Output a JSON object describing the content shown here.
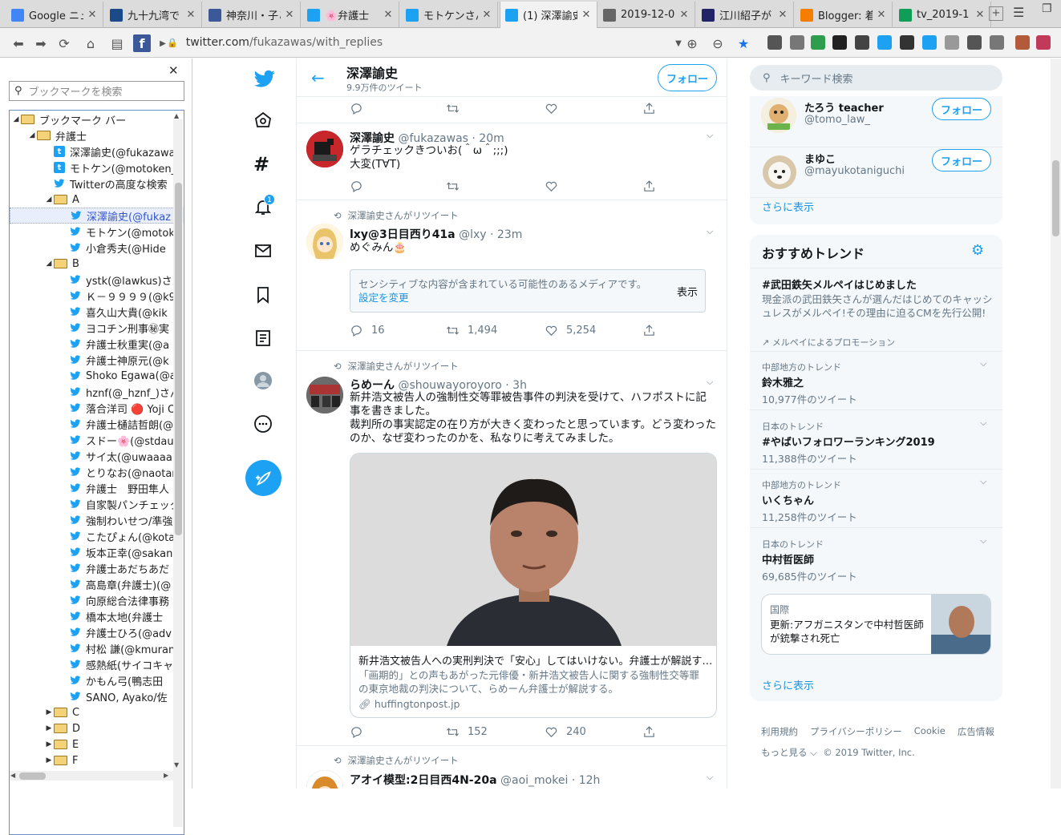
{
  "tabs": [
    {
      "title": "Google ニュ",
      "icon": "google-news-icon",
      "color": "#4285f4"
    },
    {
      "title": "九十九湾で",
      "icon": "site-icon",
      "color": "#1a4a8a"
    },
    {
      "title": "神奈川・子ど",
      "icon": "facebook-icon",
      "color": "#3b5998"
    },
    {
      "title": "🌸弁護士 ",
      "icon": "twitter-icon",
      "color": "#1da1f2"
    },
    {
      "title": "モトケンさん",
      "icon": "twitter-icon",
      "color": "#1da1f2"
    },
    {
      "title": "(1) 深澤諭史",
      "icon": "twitter-icon",
      "color": "#1da1f2"
    },
    {
      "title": "2019-12-0",
      "icon": "globe-icon",
      "color": "#666666"
    },
    {
      "title": "江川紹子が",
      "icon": "bj-icon",
      "color": "#222266"
    },
    {
      "title": "Blogger: 着",
      "icon": "blogger-icon",
      "color": "#f57d00"
    },
    {
      "title": "tv_2019-1",
      "icon": "drive-icon",
      "color": "#0f9d58"
    }
  ],
  "url": {
    "host": "twitter.com",
    "path": "/fukazawas/with_replies"
  },
  "bookmarks": {
    "search_placeholder": "ブックマークを検索",
    "items": [
      {
        "label": "ブックマーク バー",
        "kind": "folder",
        "arrow": "◢",
        "level": 0
      },
      {
        "label": "弁護士",
        "kind": "folder",
        "arrow": "◢",
        "level": 1
      },
      {
        "label": "深澤諭史(@fukazawa",
        "kind": "tsq",
        "level": 2
      },
      {
        "label": "モトケン(@motoken_",
        "kind": "tsq",
        "level": 2
      },
      {
        "label": "Twitterの高度な検索",
        "kind": "bird",
        "level": 2
      },
      {
        "label": "A",
        "kind": "folder",
        "arrow": "◢",
        "level": 2
      },
      {
        "label": "深澤諭史(@fukaz",
        "kind": "bird",
        "level": 3,
        "selected": true
      },
      {
        "label": "モトケン(@motok",
        "kind": "bird",
        "level": 3
      },
      {
        "label": "小倉秀夫(@Hide",
        "kind": "bird",
        "level": 3
      },
      {
        "label": "B",
        "kind": "folder",
        "arrow": "◢",
        "level": 2
      },
      {
        "label": "ystk(@lawkus)さん",
        "kind": "bird",
        "level": 3
      },
      {
        "label": "Ｋ－９９９９(@k99",
        "kind": "bird",
        "level": 3
      },
      {
        "label": "喜久山大貴(@kik",
        "kind": "bird",
        "level": 3
      },
      {
        "label": "ヨコチン刑事㊙実",
        "kind": "bird",
        "level": 3
      },
      {
        "label": "弁護士秋重実(@a",
        "kind": "bird",
        "level": 3
      },
      {
        "label": "弁護士神原元(@k",
        "kind": "bird",
        "level": 3
      },
      {
        "label": "Shoko Egawa(@a",
        "kind": "bird",
        "level": 3
      },
      {
        "label": "hznf(@_hznf_)さん",
        "kind": "bird",
        "level": 3
      },
      {
        "label": "落合洋司 🔴 Yoji O",
        "kind": "bird",
        "level": 3
      },
      {
        "label": "弁護士樋詰哲朗(@",
        "kind": "bird",
        "level": 3
      },
      {
        "label": "スドー🌸(@stdau",
        "kind": "bird",
        "level": 3
      },
      {
        "label": "サイ太(@uwaaaa)",
        "kind": "bird",
        "level": 3
      },
      {
        "label": "とりなお(@naotar",
        "kind": "bird",
        "level": 3
      },
      {
        "label": "弁護士　野田隼人",
        "kind": "bird",
        "level": 3
      },
      {
        "label": "自家製パンチェッタ",
        "kind": "bird",
        "level": 3
      },
      {
        "label": "強制わいせつ/準強",
        "kind": "bird",
        "level": 3
      },
      {
        "label": "こたぴょん(@kotac",
        "kind": "bird",
        "level": 3
      },
      {
        "label": "坂本正幸(@sakan",
        "kind": "bird",
        "level": 3
      },
      {
        "label": "弁護士あだちあだ",
        "kind": "bird",
        "level": 3
      },
      {
        "label": "高島章(弁護士)(@",
        "kind": "bird",
        "level": 3
      },
      {
        "label": "向原総合法律事務",
        "kind": "bird",
        "level": 3
      },
      {
        "label": "橋本太地(弁護士",
        "kind": "bird",
        "level": 3
      },
      {
        "label": "弁護士ひろ(@adv",
        "kind": "bird",
        "level": 3
      },
      {
        "label": "村松 謙(@kmuran",
        "kind": "bird",
        "level": 3
      },
      {
        "label": "感熱紙(サイコキャ",
        "kind": "bird",
        "level": 3
      },
      {
        "label": "かもん弓(鴨志田",
        "kind": "bird",
        "level": 3
      },
      {
        "label": "SANO, Ayako/佐",
        "kind": "bird",
        "level": 3
      },
      {
        "label": "C",
        "kind": "folder",
        "arrow": "▶",
        "level": 2
      },
      {
        "label": "D",
        "kind": "folder",
        "arrow": "▶",
        "level": 2
      },
      {
        "label": "E",
        "kind": "folder",
        "arrow": "▶",
        "level": 2
      },
      {
        "label": "F",
        "kind": "folder",
        "arrow": "▶",
        "level": 2
      }
    ]
  },
  "nav": {
    "notif_count": "1"
  },
  "header": {
    "name": "深澤諭史",
    "count": "9.9万件のツイート",
    "follow": "フォロー"
  },
  "tweets": {
    "t1": {
      "name": "深澤諭史",
      "handle": "@fukazawas",
      "time": "· 20m",
      "lines": [
        "ゲラチェックきついお(＾ω＾;;;)",
        "大変(T∀T)"
      ]
    },
    "t2": {
      "rt": "深澤諭史さんがリツイート",
      "name": "lxy@3日目西り41a",
      "handle": "@lxy",
      "time": "· 23m",
      "text": "めぐみん🎂",
      "sensitive": "センシティブな内容が含まれている可能性のあるメディアです。",
      "sensitive_link": "設定を変更",
      "show": "表示",
      "replies": "16",
      "retweets": "1,494",
      "likes": "5,254"
    },
    "t3": {
      "rt": "深澤諭史さんがリツイート",
      "name": "らめーん",
      "handle": "@shouwayoroyoro",
      "time": "· 3h",
      "p1": "新井浩文被告人の強制性交等罪被告事件の判決を受けて、ハフポストに記事を書きました。",
      "p2": "裁判所の事実認定の在り方が大きく変わったと思っています。どう変わったのか、なぜ変わったのかを、私なりに考えてみました。",
      "card_title": "新井浩文被告人への実刑判決で「安心」してはいけない。弁護士が解説す…",
      "card_desc": "「画期的」との声もあがった元俳優・新井浩文被告人に関する強制性交等罪の東京地裁の判決について、らめーん弁護士が解説する。",
      "card_domain": "huffingtonpost.jp",
      "replies": "",
      "retweets": "152",
      "likes": "240"
    },
    "t4": {
      "rt": "深澤諭史さんがリツイート",
      "name": "アオイ模型:2日目西4N-20a",
      "handle": "@aoi_mokei",
      "time": "· 12h"
    }
  },
  "right": {
    "search_placeholder": "キーワード検索",
    "follow": "フォロー",
    "users": [
      {
        "name": "たろう teacher",
        "handle": "@tomo_law_"
      },
      {
        "name": "まゆこ",
        "handle": "@mayukotaniguchi"
      }
    ],
    "show_more": "さらに表示",
    "trends_title": "おすすめトレンド",
    "promoted": {
      "name": "#武田鉄矢メルペイはじめました",
      "desc": "現金派の武田鉄矢さんが選んだはじめてのキャッシュレスがメルペイ!その理由に迫るCMを先行公開!",
      "by": "メルペイによるプロモーション"
    },
    "trends": [
      {
        "context": "中部地方のトレンド",
        "name": "鈴木雅之",
        "count": "10,977件のツイート"
      },
      {
        "context": "日本のトレンド",
        "name": "#やばいフォロワーランキング2019",
        "count": "11,388件のツイート"
      },
      {
        "context": "中部地方のトレンド",
        "name": "いくちゃん",
        "count": "11,258件のツイート"
      },
      {
        "context": "日本のトレンド",
        "name": "中村哲医師",
        "count": "69,685件のツイート"
      }
    ],
    "news": {
      "category": "国際",
      "headline": "更新:アフガニスタンで中村哲医師が銃撃され死亡"
    },
    "footer": [
      "利用規約",
      "プライバシーポリシー",
      "Cookie",
      "広告情報"
    ],
    "footer2": "もっと見る ⌵",
    "copyright": "© 2019 Twitter, Inc."
  }
}
